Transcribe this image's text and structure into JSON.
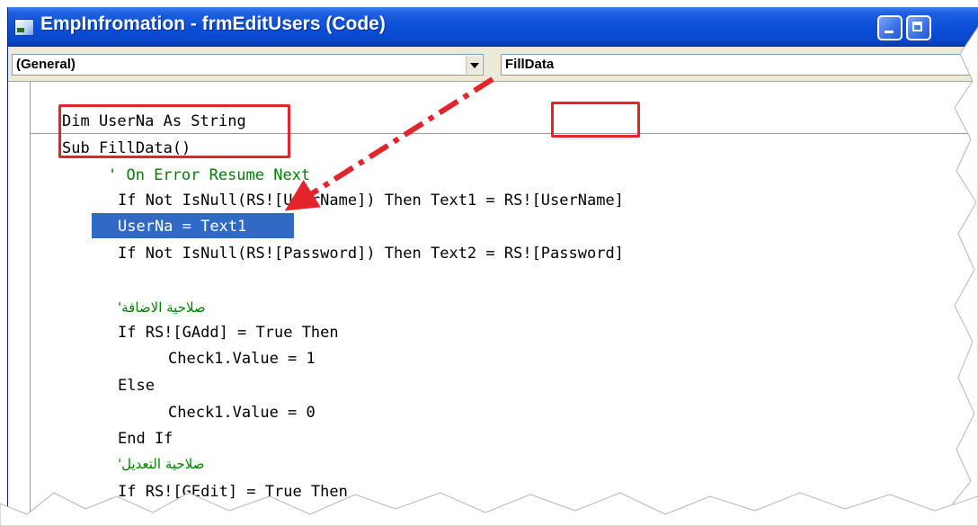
{
  "window": {
    "title": "EmpInfromation - frmEditUsers (Code)"
  },
  "toolbar": {
    "object_combo": "(General)",
    "procedure_combo": "FillData"
  },
  "code": {
    "lines": [
      "Dim UserNa As String",
      "Sub FillData()",
      "' On Error Resume Next",
      "If Not IsNull(RS![UserName]) Then Text1 = RS![UserName]",
      "UserNa = Text1",
      "If Not IsNull(RS![Password]) Then Text2 = RS![Password]",
      "",
      "'صلاحية الاضافة",
      "If RS![GAdd] = True Then",
      "Check1.Value = 1",
      "Else",
      "Check1.Value = 0",
      "End If",
      "'صلاحية التعديل",
      "If RS![GEdit] = True Then"
    ]
  },
  "colors": {
    "titlebar": "#0b4fd8",
    "selection": "#316ac5",
    "comment": "#008000",
    "highlight": "#e3242b"
  },
  "icons": {
    "window_icon": "vb-code-window-icon",
    "minimize": "minimize-icon",
    "maximize": "maximize-icon",
    "dropdown": "chevron-down-icon"
  }
}
